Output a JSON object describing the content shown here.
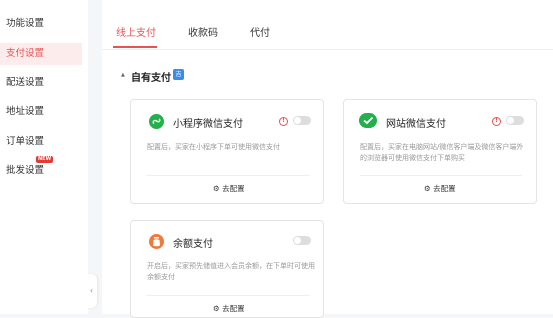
{
  "sidebar": {
    "items": [
      {
        "label": "功能设置"
      },
      {
        "label": "支付设置"
      },
      {
        "label": "配送设置"
      },
      {
        "label": "地址设置"
      },
      {
        "label": "订单设置"
      },
      {
        "label": "批发设置",
        "badge": "NEW"
      }
    ],
    "active_index": 1,
    "collapse_icon": "‹"
  },
  "tabs": [
    {
      "label": "线上支付"
    },
    {
      "label": "收款码"
    },
    {
      "label": "代付"
    }
  ],
  "section": {
    "title": "自有支付",
    "icon": "吉"
  },
  "cards": {
    "mini": {
      "title": "小程序微信支付",
      "desc": "配置后，买家在小程序下单可使用微信支付",
      "config": "去配置"
    },
    "web": {
      "title": "网站微信支付",
      "desc": "配置后，买家在电脑网站/微信客户端及微信客户端外的浏览器可使用微信支付下单购买",
      "config": "去配置"
    },
    "balance": {
      "title": "余额支付",
      "desc": "开启后，买家预先储值进入会员余额，在下单时可使用余额支付",
      "config": "去配置"
    }
  },
  "colors": {
    "accent": "#e55353",
    "wechat_green": "#21b04a",
    "balance_orange": "#f07a3c"
  }
}
